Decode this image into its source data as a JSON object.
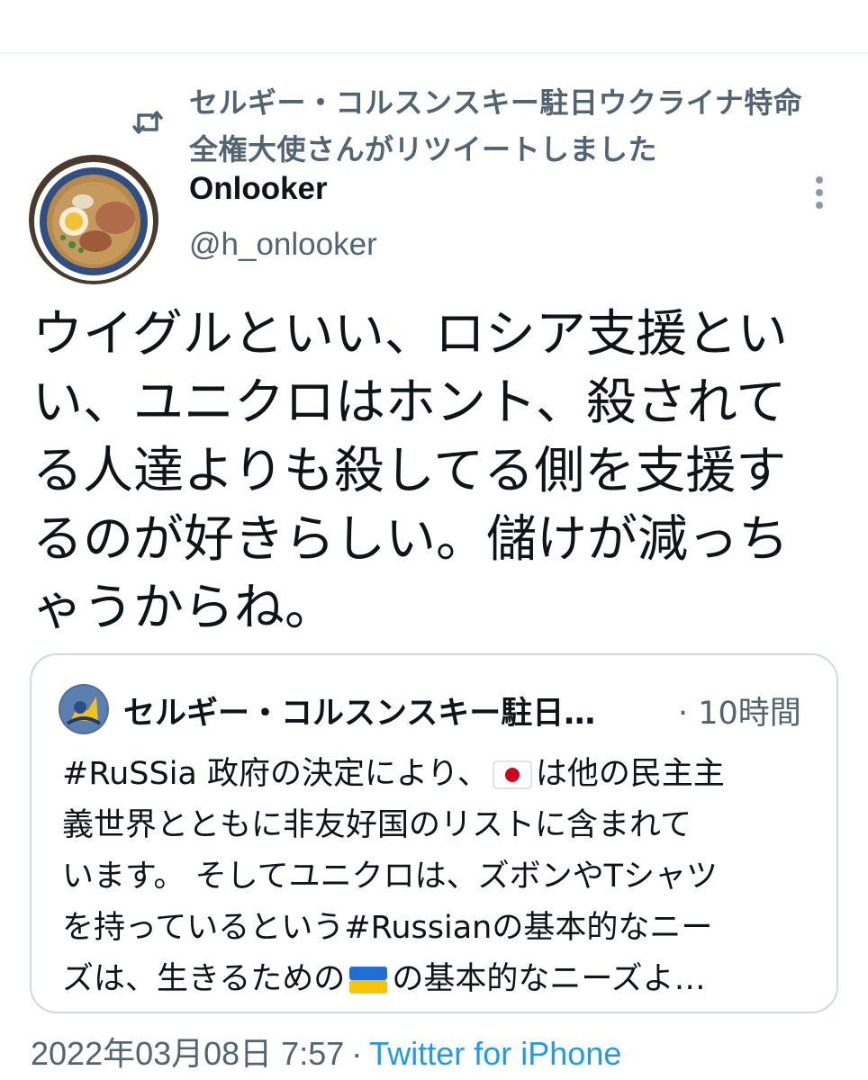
{
  "retweet": {
    "line1": "セルギー・コルスンスキー駐日ウクライナ特命",
    "line2": "全権大使さんがリツイートしました",
    "icon": "retweet-icon"
  },
  "tweet": {
    "author_name": "Onlooker",
    "author_handle": "@h_onlooker",
    "text_lines": [
      "ウイグルといい、ロシア支援とい",
      "い、ユニクロはホント、殺されて",
      "る人達よりも殺してる側を支援す",
      "るのが好きらしい。儲けが減っち",
      "ゃうからね。"
    ],
    "timestamp": "2022年03月08日 7:57",
    "separator": "·",
    "source": "Twitter for iPhone"
  },
  "quote": {
    "author_name": "セルギー・コルスンスキー駐日…",
    "time": "· 10時間",
    "line1_pre": "#RuSSia 政府の決定により、",
    "line1_post": "は他の民主主",
    "line2": "義世界とともに非友好国のリストに含まれて",
    "line3": "います。 そしてユニクロは、ズボンやTシャツ",
    "line4": "を持っているという#Russianの基本的なニー",
    "line5_pre": "ズは、生きるための",
    "line5_post": "の基本的なニーズよ…"
  },
  "colors": {
    "text": "#0f1419",
    "secondary": "#536471",
    "link": "#1d9bf0",
    "border": "#cfd9de"
  }
}
